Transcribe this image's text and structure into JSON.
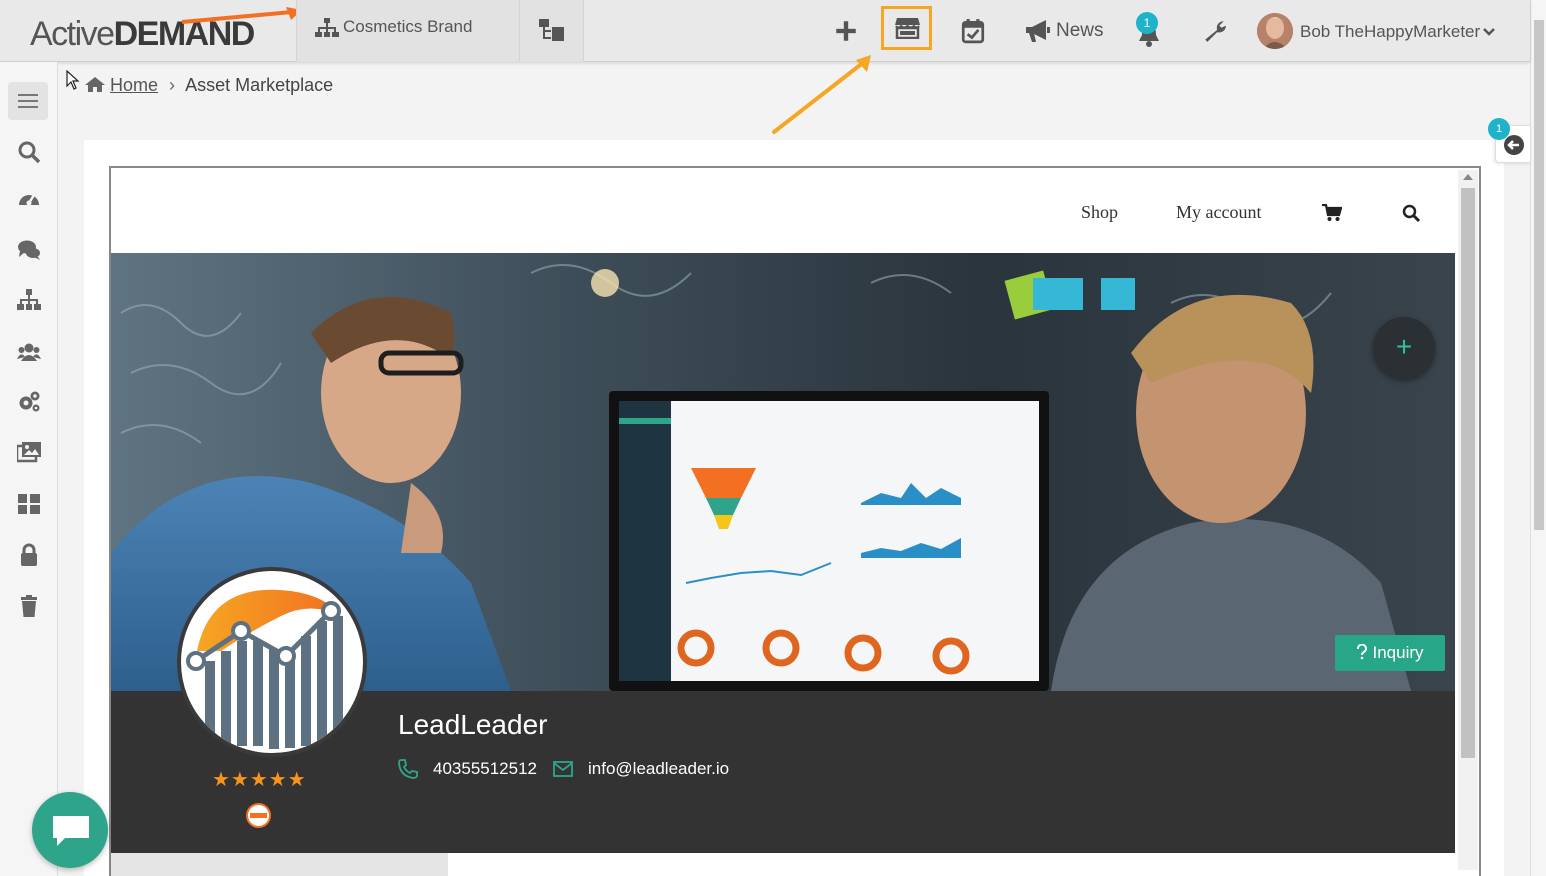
{
  "app": {
    "logo_part1": "Active",
    "logo_part2": "DEMAND",
    "brand_selector": "Cosmetics Brand",
    "news_label": "News",
    "notification_count": "1",
    "user_name": "Bob TheHappyMarketer",
    "accent_color": "#f5a623"
  },
  "breadcrumb": {
    "home": "Home",
    "separator": "›",
    "current": "Asset Marketplace"
  },
  "side_panel": {
    "badge_count": "1"
  },
  "store": {
    "nav": {
      "shop": "Shop",
      "account": "My account"
    },
    "profile": {
      "company": "LeadLeader",
      "phone": "40355512512",
      "email": "info@leadleader.io",
      "rating_stars": "★★★★★",
      "rating_value": 5
    },
    "inquiry_label": "Inquiry",
    "fab_label": "+"
  },
  "sidebar": {
    "items": [
      "menu-icon",
      "search-icon",
      "dashboard-icon",
      "chat-icon",
      "sitemap-icon",
      "users-icon",
      "settings-icon",
      "media-icon",
      "apps-icon",
      "lock-icon",
      "trash-icon"
    ]
  },
  "colors": {
    "chat_bubble": "#2ea58a",
    "inquiry_button": "#28a788",
    "notification_badge": "#1fb3c9",
    "profile_band": "#333333"
  }
}
